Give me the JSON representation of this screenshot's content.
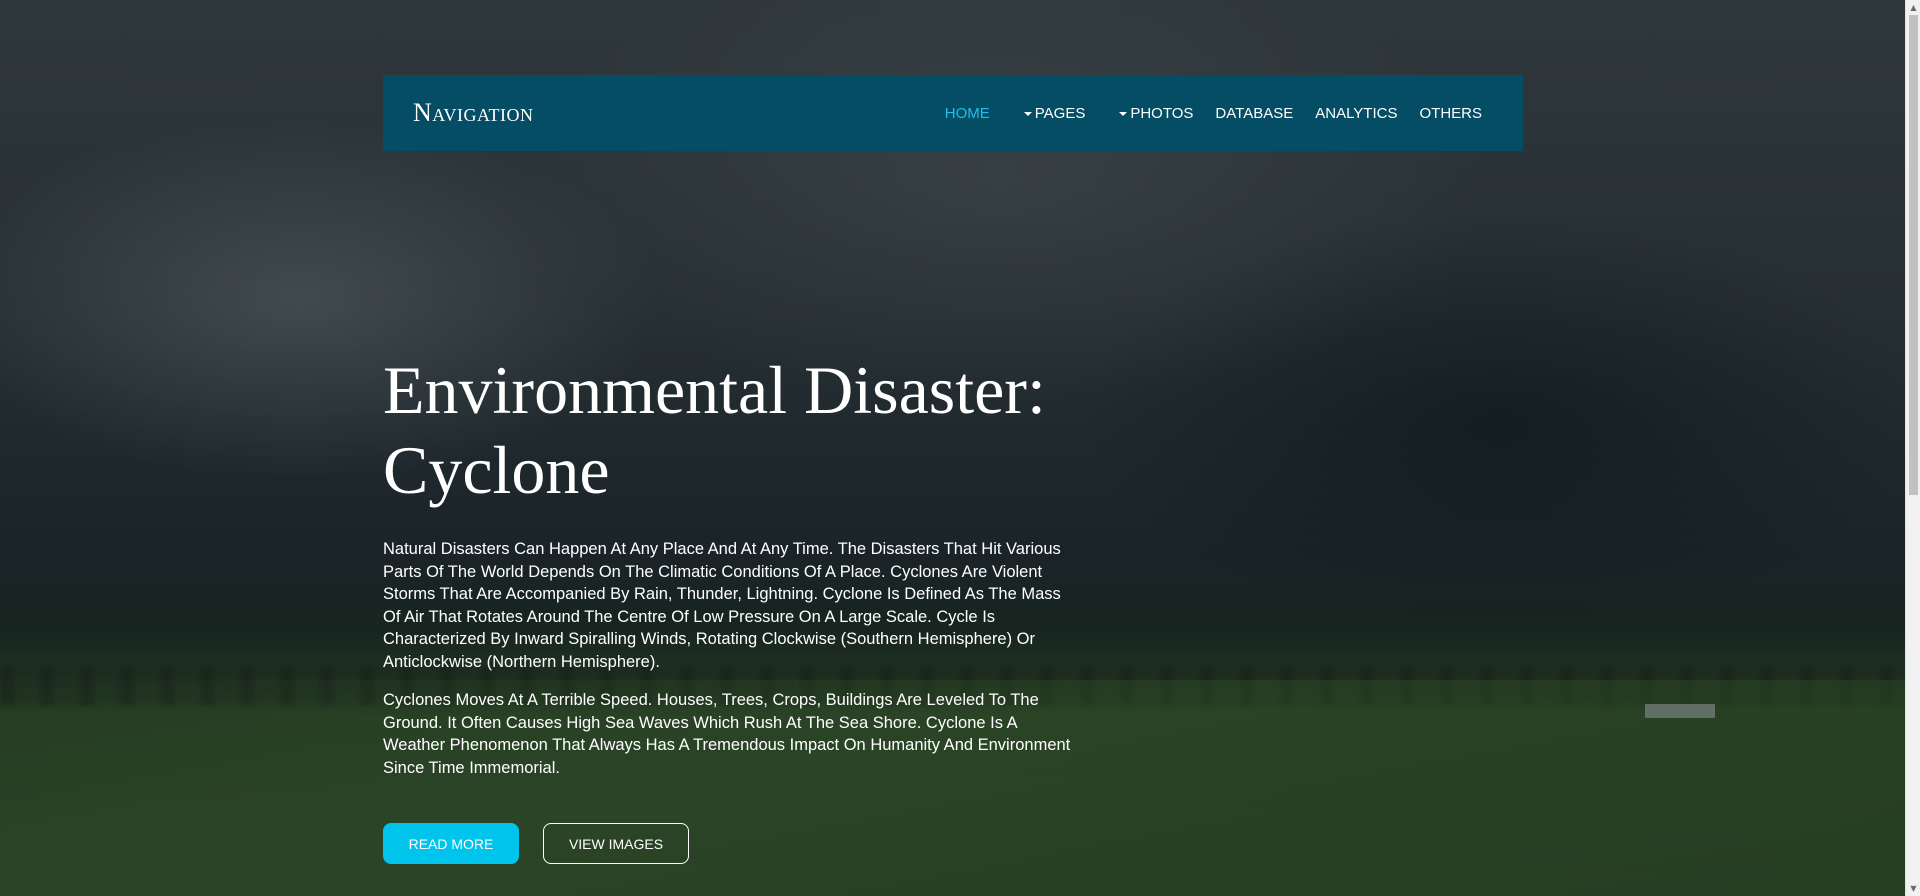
{
  "navbar": {
    "brand": "Navigation",
    "items": [
      {
        "label": "HOME",
        "active": true,
        "dropdown": false
      },
      {
        "label": "PAGES",
        "active": false,
        "dropdown": true
      },
      {
        "label": "PHOTOS",
        "active": false,
        "dropdown": true
      },
      {
        "label": "DATABASE",
        "active": false,
        "dropdown": false
      },
      {
        "label": "ANALYTICS",
        "active": false,
        "dropdown": false
      },
      {
        "label": "OTHERS",
        "active": false,
        "dropdown": false
      }
    ]
  },
  "hero": {
    "title": "Environmental Disaster: Cyclone",
    "paragraphs": [
      "Natural Disasters Can Happen At Any Place And At Any Time. The Disasters That Hit Various Parts Of The World Depends On The Climatic Conditions Of A Place. Cyclones Are Violent Storms That Are Accompanied By Rain, Thunder, Lightning. Cyclone Is Defined As The Mass Of Air That Rotates Around The Centre Of Low Pressure On A Large Scale. Cycle Is Characterized By Inward Spiralling Winds, Rotating Clockwise (Southern Hemisphere) Or Anticlockwise (Northern Hemisphere).",
      "Cyclones Moves At A Terrible Speed. Houses, Trees, Crops, Buildings Are Leveled To The Ground. It Often Causes High Sea Waves Which Rush At The Sea Shore. Cyclone Is A Weather Phenomenon That Always Has A Tremendous Impact On Humanity And Environment Since Time Immemorial."
    ],
    "buttons": {
      "read_more": "READ MORE",
      "view_images": "VIEW IMAGES"
    }
  },
  "colors": {
    "navbar_bg": "#054d64",
    "active_link": "#1cc0ea",
    "primary_button": "#00c4ec"
  },
  "icons": {
    "dropdown": "caret-down-icon",
    "scroll_up": "scroll-up-arrow-icon",
    "scroll_down": "scroll-down-arrow-icon"
  }
}
